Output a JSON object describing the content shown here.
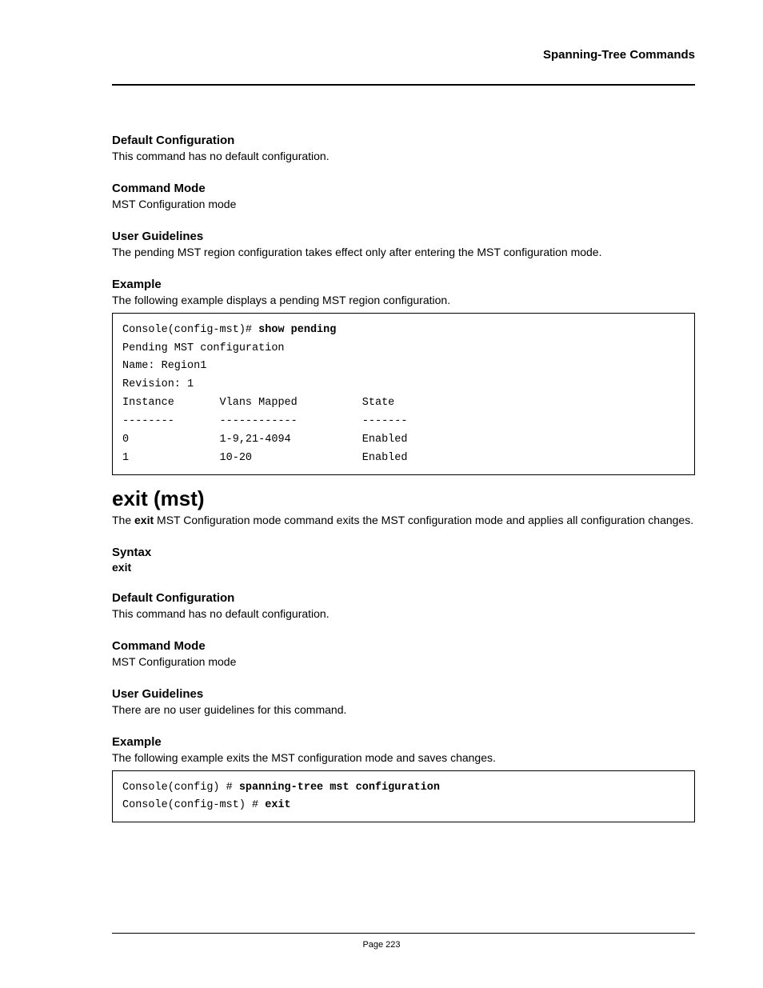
{
  "header": {
    "title": "Spanning-Tree Commands"
  },
  "sections1": {
    "default_config_h": "Default Configuration",
    "default_config_t": "This command has no default configuration.",
    "command_mode_h": "Command Mode",
    "command_mode_t": "MST Configuration mode",
    "user_guidelines_h": "User Guidelines",
    "user_guidelines_t": "The pending MST region configuration takes effect only after entering the MST configuration mode.",
    "example_h": "Example",
    "example_t": "The following example displays a pending MST region configuration."
  },
  "code1": {
    "line1_prompt": "Console(config-mst)# ",
    "line1_cmd": "show pending",
    "line2": "Pending MST configuration",
    "line3": "Name: Region1",
    "line4": "Revision: 1",
    "line5_c1": "Instance",
    "line5_c2": "Vlans Mapped",
    "line5_c3": "State",
    "line6_c1": "--------",
    "line6_c2": "------------",
    "line6_c3": "-------",
    "line7_c1": "0",
    "line7_c2": "1-9,21-4094",
    "line7_c3": "Enabled",
    "line8_c1": "1",
    "line8_c2": "10-20",
    "line8_c3": "Enabled"
  },
  "cmd_heading": "exit (mst)",
  "cmd_desc_pre": "The ",
  "cmd_desc_bold": "exit",
  "cmd_desc_post": " MST Configuration mode command exits the MST configuration mode and applies all configuration changes.",
  "sections2": {
    "syntax_h": "Syntax",
    "syntax_word": "exit",
    "default_config_h": "Default Configuration",
    "default_config_t": "This command has no default configuration.",
    "command_mode_h": "Command Mode",
    "command_mode_t": "MST Configuration mode",
    "user_guidelines_h": "User Guidelines",
    "user_guidelines_t": "There are no user guidelines for this command.",
    "example_h": "Example",
    "example_t": "The following example exits the MST configuration mode and saves changes."
  },
  "code2": {
    "line1_prompt": "Console(config) # ",
    "line1_cmd": "spanning-tree mst configuration",
    "line2_prompt": "Console(config-mst) # ",
    "line2_cmd": "exit"
  },
  "footer": {
    "page": "Page 223"
  }
}
